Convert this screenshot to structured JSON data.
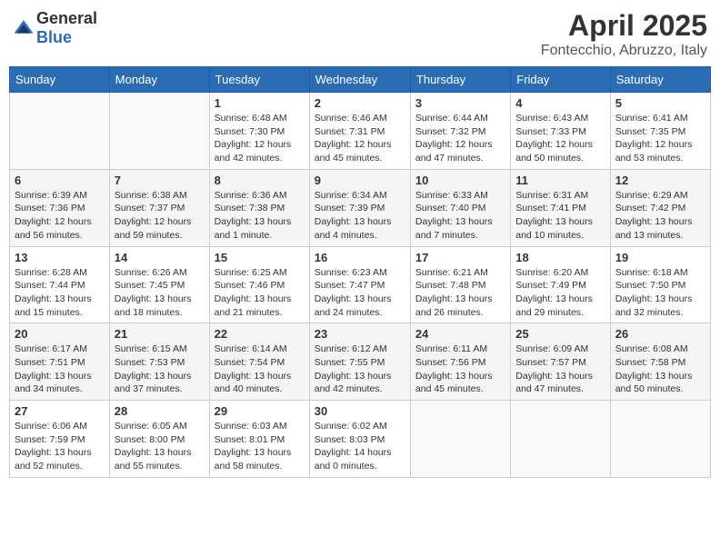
{
  "header": {
    "logo_general": "General",
    "logo_blue": "Blue",
    "month_title": "April 2025",
    "location": "Fontecchio, Abruzzo, Italy"
  },
  "weekdays": [
    "Sunday",
    "Monday",
    "Tuesday",
    "Wednesday",
    "Thursday",
    "Friday",
    "Saturday"
  ],
  "weeks": [
    [
      {
        "day": "",
        "sunrise": "",
        "sunset": "",
        "daylight": ""
      },
      {
        "day": "",
        "sunrise": "",
        "sunset": "",
        "daylight": ""
      },
      {
        "day": "1",
        "sunrise": "Sunrise: 6:48 AM",
        "sunset": "Sunset: 7:30 PM",
        "daylight": "Daylight: 12 hours and 42 minutes."
      },
      {
        "day": "2",
        "sunrise": "Sunrise: 6:46 AM",
        "sunset": "Sunset: 7:31 PM",
        "daylight": "Daylight: 12 hours and 45 minutes."
      },
      {
        "day": "3",
        "sunrise": "Sunrise: 6:44 AM",
        "sunset": "Sunset: 7:32 PM",
        "daylight": "Daylight: 12 hours and 47 minutes."
      },
      {
        "day": "4",
        "sunrise": "Sunrise: 6:43 AM",
        "sunset": "Sunset: 7:33 PM",
        "daylight": "Daylight: 12 hours and 50 minutes."
      },
      {
        "day": "5",
        "sunrise": "Sunrise: 6:41 AM",
        "sunset": "Sunset: 7:35 PM",
        "daylight": "Daylight: 12 hours and 53 minutes."
      }
    ],
    [
      {
        "day": "6",
        "sunrise": "Sunrise: 6:39 AM",
        "sunset": "Sunset: 7:36 PM",
        "daylight": "Daylight: 12 hours and 56 minutes."
      },
      {
        "day": "7",
        "sunrise": "Sunrise: 6:38 AM",
        "sunset": "Sunset: 7:37 PM",
        "daylight": "Daylight: 12 hours and 59 minutes."
      },
      {
        "day": "8",
        "sunrise": "Sunrise: 6:36 AM",
        "sunset": "Sunset: 7:38 PM",
        "daylight": "Daylight: 13 hours and 1 minute."
      },
      {
        "day": "9",
        "sunrise": "Sunrise: 6:34 AM",
        "sunset": "Sunset: 7:39 PM",
        "daylight": "Daylight: 13 hours and 4 minutes."
      },
      {
        "day": "10",
        "sunrise": "Sunrise: 6:33 AM",
        "sunset": "Sunset: 7:40 PM",
        "daylight": "Daylight: 13 hours and 7 minutes."
      },
      {
        "day": "11",
        "sunrise": "Sunrise: 6:31 AM",
        "sunset": "Sunset: 7:41 PM",
        "daylight": "Daylight: 13 hours and 10 minutes."
      },
      {
        "day": "12",
        "sunrise": "Sunrise: 6:29 AM",
        "sunset": "Sunset: 7:42 PM",
        "daylight": "Daylight: 13 hours and 13 minutes."
      }
    ],
    [
      {
        "day": "13",
        "sunrise": "Sunrise: 6:28 AM",
        "sunset": "Sunset: 7:44 PM",
        "daylight": "Daylight: 13 hours and 15 minutes."
      },
      {
        "day": "14",
        "sunrise": "Sunrise: 6:26 AM",
        "sunset": "Sunset: 7:45 PM",
        "daylight": "Daylight: 13 hours and 18 minutes."
      },
      {
        "day": "15",
        "sunrise": "Sunrise: 6:25 AM",
        "sunset": "Sunset: 7:46 PM",
        "daylight": "Daylight: 13 hours and 21 minutes."
      },
      {
        "day": "16",
        "sunrise": "Sunrise: 6:23 AM",
        "sunset": "Sunset: 7:47 PM",
        "daylight": "Daylight: 13 hours and 24 minutes."
      },
      {
        "day": "17",
        "sunrise": "Sunrise: 6:21 AM",
        "sunset": "Sunset: 7:48 PM",
        "daylight": "Daylight: 13 hours and 26 minutes."
      },
      {
        "day": "18",
        "sunrise": "Sunrise: 6:20 AM",
        "sunset": "Sunset: 7:49 PM",
        "daylight": "Daylight: 13 hours and 29 minutes."
      },
      {
        "day": "19",
        "sunrise": "Sunrise: 6:18 AM",
        "sunset": "Sunset: 7:50 PM",
        "daylight": "Daylight: 13 hours and 32 minutes."
      }
    ],
    [
      {
        "day": "20",
        "sunrise": "Sunrise: 6:17 AM",
        "sunset": "Sunset: 7:51 PM",
        "daylight": "Daylight: 13 hours and 34 minutes."
      },
      {
        "day": "21",
        "sunrise": "Sunrise: 6:15 AM",
        "sunset": "Sunset: 7:53 PM",
        "daylight": "Daylight: 13 hours and 37 minutes."
      },
      {
        "day": "22",
        "sunrise": "Sunrise: 6:14 AM",
        "sunset": "Sunset: 7:54 PM",
        "daylight": "Daylight: 13 hours and 40 minutes."
      },
      {
        "day": "23",
        "sunrise": "Sunrise: 6:12 AM",
        "sunset": "Sunset: 7:55 PM",
        "daylight": "Daylight: 13 hours and 42 minutes."
      },
      {
        "day": "24",
        "sunrise": "Sunrise: 6:11 AM",
        "sunset": "Sunset: 7:56 PM",
        "daylight": "Daylight: 13 hours and 45 minutes."
      },
      {
        "day": "25",
        "sunrise": "Sunrise: 6:09 AM",
        "sunset": "Sunset: 7:57 PM",
        "daylight": "Daylight: 13 hours and 47 minutes."
      },
      {
        "day": "26",
        "sunrise": "Sunrise: 6:08 AM",
        "sunset": "Sunset: 7:58 PM",
        "daylight": "Daylight: 13 hours and 50 minutes."
      }
    ],
    [
      {
        "day": "27",
        "sunrise": "Sunrise: 6:06 AM",
        "sunset": "Sunset: 7:59 PM",
        "daylight": "Daylight: 13 hours and 52 minutes."
      },
      {
        "day": "28",
        "sunrise": "Sunrise: 6:05 AM",
        "sunset": "Sunset: 8:00 PM",
        "daylight": "Daylight: 13 hours and 55 minutes."
      },
      {
        "day": "29",
        "sunrise": "Sunrise: 6:03 AM",
        "sunset": "Sunset: 8:01 PM",
        "daylight": "Daylight: 13 hours and 58 minutes."
      },
      {
        "day": "30",
        "sunrise": "Sunrise: 6:02 AM",
        "sunset": "Sunset: 8:03 PM",
        "daylight": "Daylight: 14 hours and 0 minutes."
      },
      {
        "day": "",
        "sunrise": "",
        "sunset": "",
        "daylight": ""
      },
      {
        "day": "",
        "sunrise": "",
        "sunset": "",
        "daylight": ""
      },
      {
        "day": "",
        "sunrise": "",
        "sunset": "",
        "daylight": ""
      }
    ]
  ]
}
